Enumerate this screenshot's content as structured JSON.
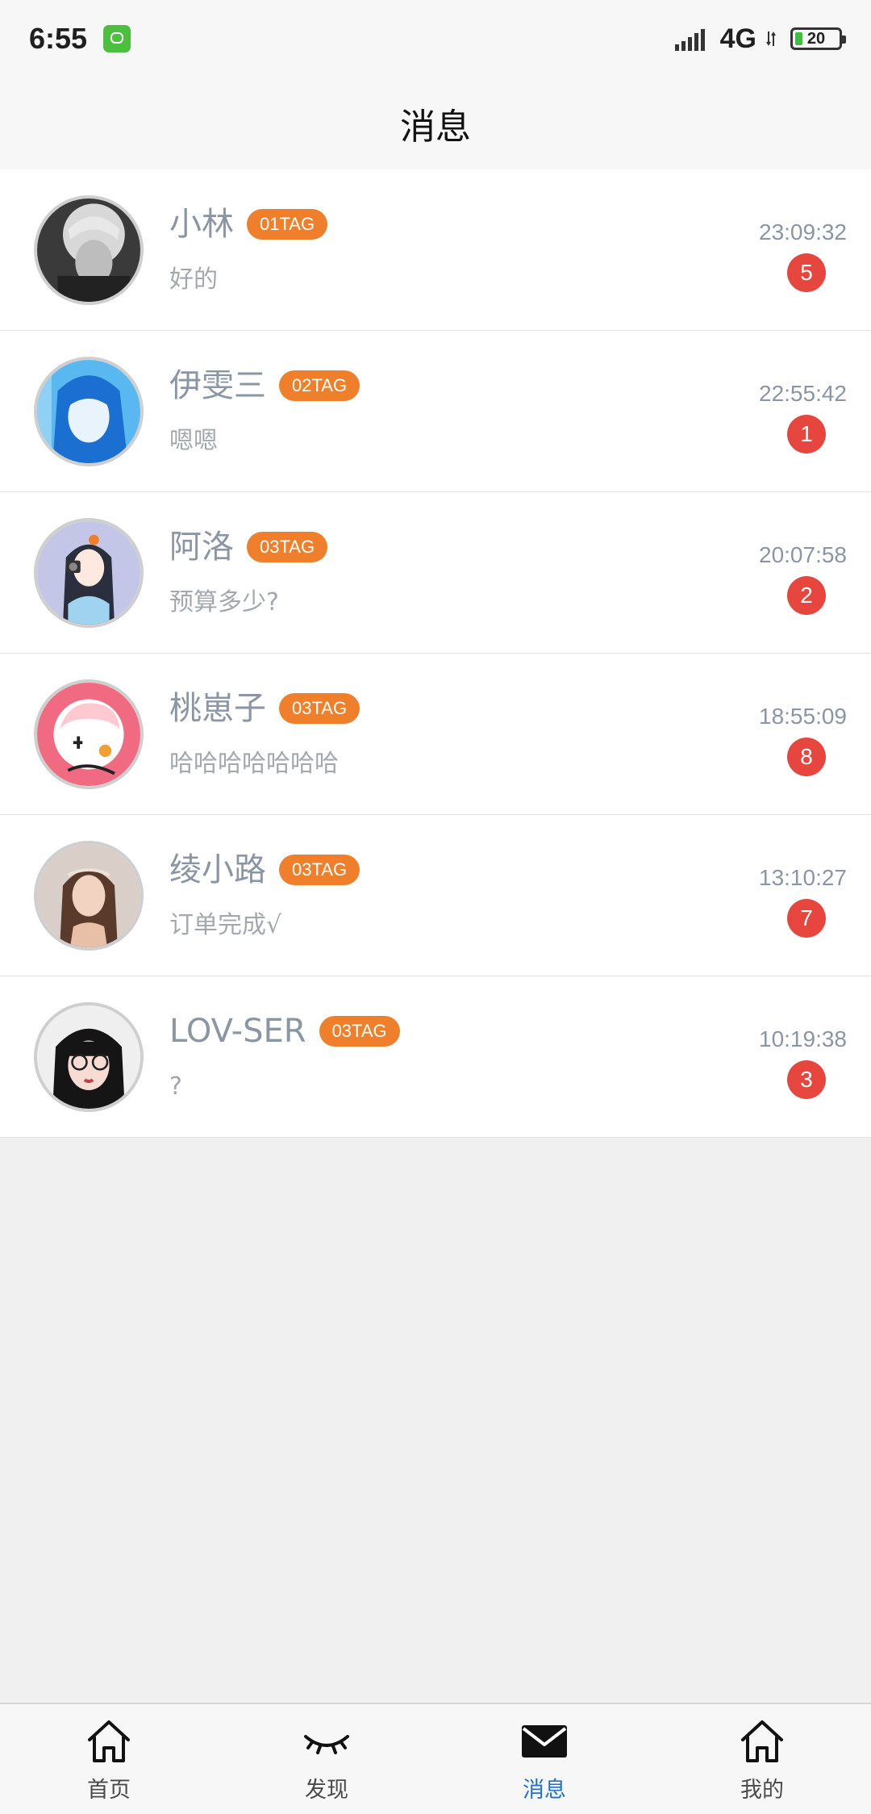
{
  "status_bar": {
    "time": "6:55",
    "network": "4G",
    "battery": "20"
  },
  "header": {
    "title": "消息"
  },
  "messages": [
    {
      "name": "小林",
      "tag": "01TAG",
      "preview": "好的",
      "time": "23:09:32",
      "unread": "5"
    },
    {
      "name": "伊雯三",
      "tag": "02TAG",
      "preview": "嗯嗯",
      "time": "22:55:42",
      "unread": "1"
    },
    {
      "name": "阿洛",
      "tag": "03TAG",
      "preview": "预算多少?",
      "time": "20:07:58",
      "unread": "2"
    },
    {
      "name": "桃崽子",
      "tag": "03TAG",
      "preview": "哈哈哈哈哈哈哈",
      "time": "18:55:09",
      "unread": "8"
    },
    {
      "name": "绫小路",
      "tag": "03TAG",
      "preview": "订单完成√",
      "time": "13:10:27",
      "unread": "7"
    },
    {
      "name": "LOV-SER",
      "tag": "03TAG",
      "preview": "?",
      "time": "10:19:38",
      "unread": "3"
    }
  ],
  "bottom_nav": [
    {
      "label": "首页",
      "icon": "home-icon"
    },
    {
      "label": "发现",
      "icon": "eye-closed-icon"
    },
    {
      "label": "消息",
      "icon": "mail-icon"
    },
    {
      "label": "我的",
      "icon": "home-icon"
    }
  ],
  "colors": {
    "accent": "#1e73c8",
    "tag": "#f07f2c",
    "badge": "#e6463e",
    "name_text": "#8a96a3"
  }
}
